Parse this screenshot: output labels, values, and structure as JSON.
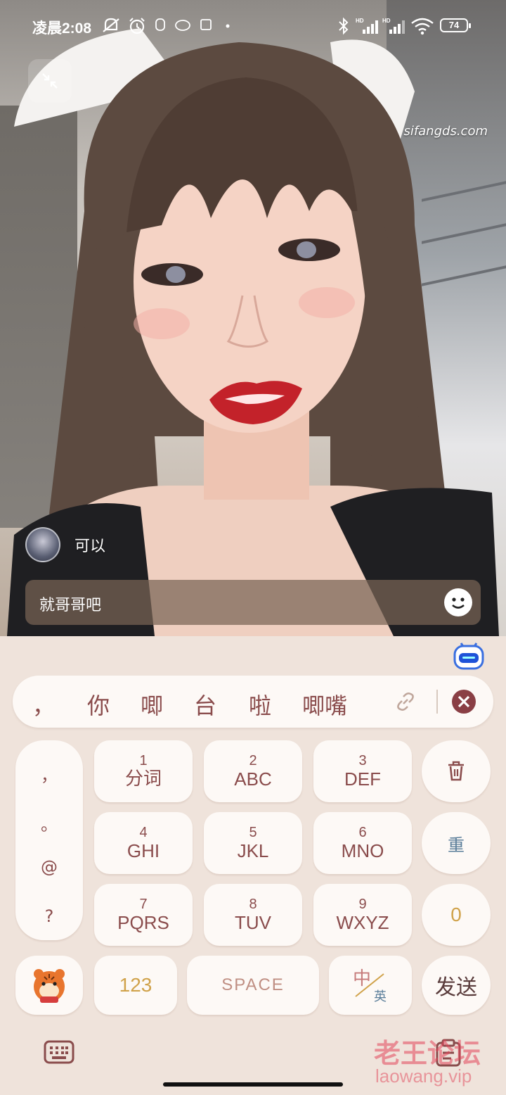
{
  "status_bar": {
    "time": "凌晨2:08",
    "battery": "74",
    "icons": [
      "mute-icon",
      "alarm-icon",
      "app-notification-icon",
      "cloud-icon",
      "media-icon",
      "dot-icon",
      "bluetooth-icon",
      "signal-hd-1-icon",
      "signal-hd-2-icon",
      "wifi-icon",
      "battery-icon"
    ]
  },
  "video": {
    "site_watermark": "sifangds.com",
    "minimize_icon": "minimize-icon"
  },
  "chat": {
    "messages": [
      {
        "text": "可以"
      }
    ]
  },
  "input": {
    "value": "就哥哥吧",
    "emoji_icon": "emoji-icon"
  },
  "keyboard": {
    "candidates": [
      "，",
      "你",
      "唧",
      "台",
      "啦",
      "唧嘴"
    ],
    "link_icon": "link-icon",
    "close_icon": "close-icon",
    "keys": [
      {
        "num": "1",
        "letters": "分词"
      },
      {
        "num": "2",
        "letters": "ABC"
      },
      {
        "num": "3",
        "letters": "DEF"
      },
      {
        "num": "4",
        "letters": "GHI"
      },
      {
        "num": "5",
        "letters": "JKL"
      },
      {
        "num": "6",
        "letters": "MNO"
      },
      {
        "num": "7",
        "letters": "PQRS"
      },
      {
        "num": "8",
        "letters": "TUV"
      },
      {
        "num": "9",
        "letters": "WXYZ"
      }
    ],
    "punctuation": [
      "，",
      "。",
      "@",
      "?"
    ],
    "delete_icon": "trash-icon",
    "retype_label": "重",
    "zero_label": "0",
    "num_mode_label": "123",
    "space_label": "SPACE",
    "lang_zh": "中",
    "lang_en": "英",
    "send_label": "发送",
    "sticker_icon": "tiger-sticker-icon",
    "keyboard_icon": "keyboard-icon",
    "clipboard_icon": "clipboard-icon"
  },
  "watermark": {
    "brand": "老王论坛",
    "url": "laowang.vip"
  },
  "colors": {
    "key_text": "#8a4c4c",
    "keyboard_bg": "#efe3db",
    "key_bg": "#fdf9f6"
  }
}
